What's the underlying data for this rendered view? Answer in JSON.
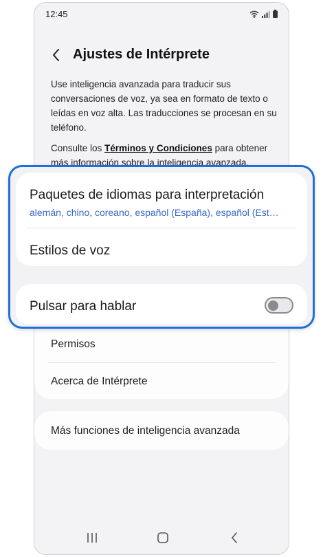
{
  "status_bar": {
    "time": "12:45"
  },
  "header": {
    "title": "Ajustes de Intérprete"
  },
  "description": "Use inteligencia avanzada para traducir sus conversaciones de voz, ya sea en formato de texto o leídas en voz alta. Las traducciones se procesan en su teléfono.",
  "terms": {
    "prefix": "Consulte los ",
    "link": "Términos y Condiciones",
    "suffix": " para obtener más información sobre la inteligencia avanzada."
  },
  "settings": {
    "language_packs": {
      "title": "Paquetes de idiomas para interpretación",
      "subtitle": "alemán, chino, coreano, español (España), español (Est…"
    },
    "voice_styles": "Estilos de voz",
    "push_to_talk": {
      "label": "Pulsar para hablar",
      "enabled": false
    },
    "permissions": "Permisos",
    "about": "Acerca de Intérprete",
    "more_features": "Más funciones de inteligencia avanzada"
  },
  "colors": {
    "accent_outline": "#1e6fd9",
    "subtitle_blue": "#3767c9"
  }
}
